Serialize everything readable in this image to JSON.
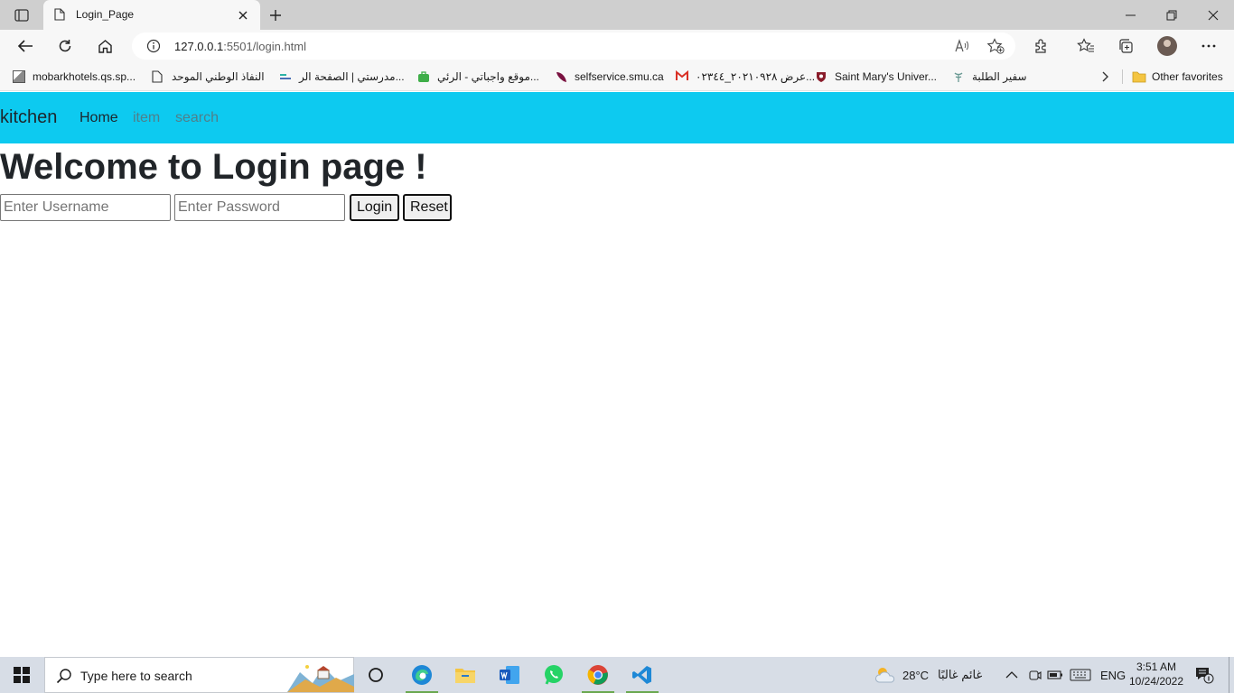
{
  "browser": {
    "tab_title": "Login_Page",
    "url_host": "127.0.0.1",
    "url_rest": ":5501/login.html"
  },
  "favorites": {
    "items": [
      {
        "label": "mobarkhotels.qs.sp...",
        "icon": "image-icon"
      },
      {
        "label": "النفاذ الوطني الموحد",
        "icon": "page-icon"
      },
      {
        "label": "مدرستي | الصفحة الر...",
        "icon": "madrasati-icon"
      },
      {
        "label": "موقع واجباتي - الرئي...",
        "icon": "briefcase-icon"
      },
      {
        "label": "selfservice.smu.ca",
        "icon": "feather-icon"
      },
      {
        "label": "عرض ٢٠٢١٠٩٢٨_٠٢٣٤٤...",
        "icon": "gmail-icon"
      },
      {
        "label": "Saint Mary's Univer...",
        "icon": "smu-crest-icon"
      },
      {
        "label": "سفير الطلبة",
        "icon": "safeer-icon"
      }
    ],
    "other_label": "Other favorites"
  },
  "page": {
    "brand": "kitchen",
    "nav": [
      {
        "label": "Home"
      },
      {
        "label": "item"
      },
      {
        "label": "search"
      }
    ],
    "heading": "Welcome to Login page !",
    "username_placeholder": "Enter Username",
    "password_placeholder": "Enter Password",
    "login_label": "Login",
    "reset_label": "Reset"
  },
  "taskbar": {
    "search_placeholder": "Type here to search",
    "weather_temp": "28°C",
    "weather_text": "غائم غالبًا",
    "language": "ENG",
    "time": "3:51 AM",
    "date": "10/24/2022"
  },
  "colors": {
    "navbar": "#0dcaf0",
    "tabstrip": "#cfcfcf",
    "toolbar": "#f7f7f7",
    "taskbar": "#d7dde6"
  }
}
